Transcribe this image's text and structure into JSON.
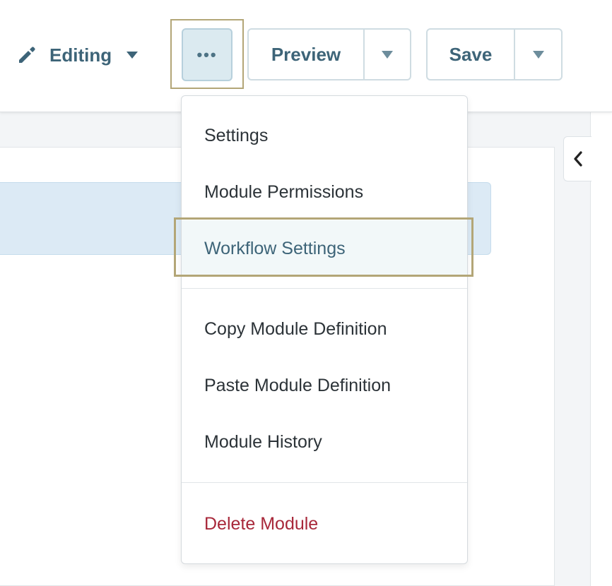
{
  "toolbar": {
    "editing_label": "Editing",
    "more_label": "•••",
    "preview_label": "Preview",
    "save_label": "Save"
  },
  "menu": {
    "items": [
      {
        "label": "Settings"
      },
      {
        "label": "Module Permissions"
      },
      {
        "label": "Workflow Settings"
      },
      {
        "label": "Copy Module Definition"
      },
      {
        "label": "Paste Module Definition"
      },
      {
        "label": "Module History"
      },
      {
        "label": "Delete Module"
      }
    ],
    "highlighted": "Workflow Settings"
  },
  "icons": {
    "editing": "pencil-icon",
    "editing_dropdown": "caret-down-icon",
    "more": "ellipsis-icon",
    "preview_dropdown": "caret-down-icon",
    "save_dropdown": "caret-down-icon",
    "collapse_panel": "chevron-left-icon"
  },
  "colors": {
    "accent": "#3d6478",
    "danger": "#a8283a",
    "highlight_frame": "#b3a677",
    "selected_row": "#dceaf5"
  }
}
